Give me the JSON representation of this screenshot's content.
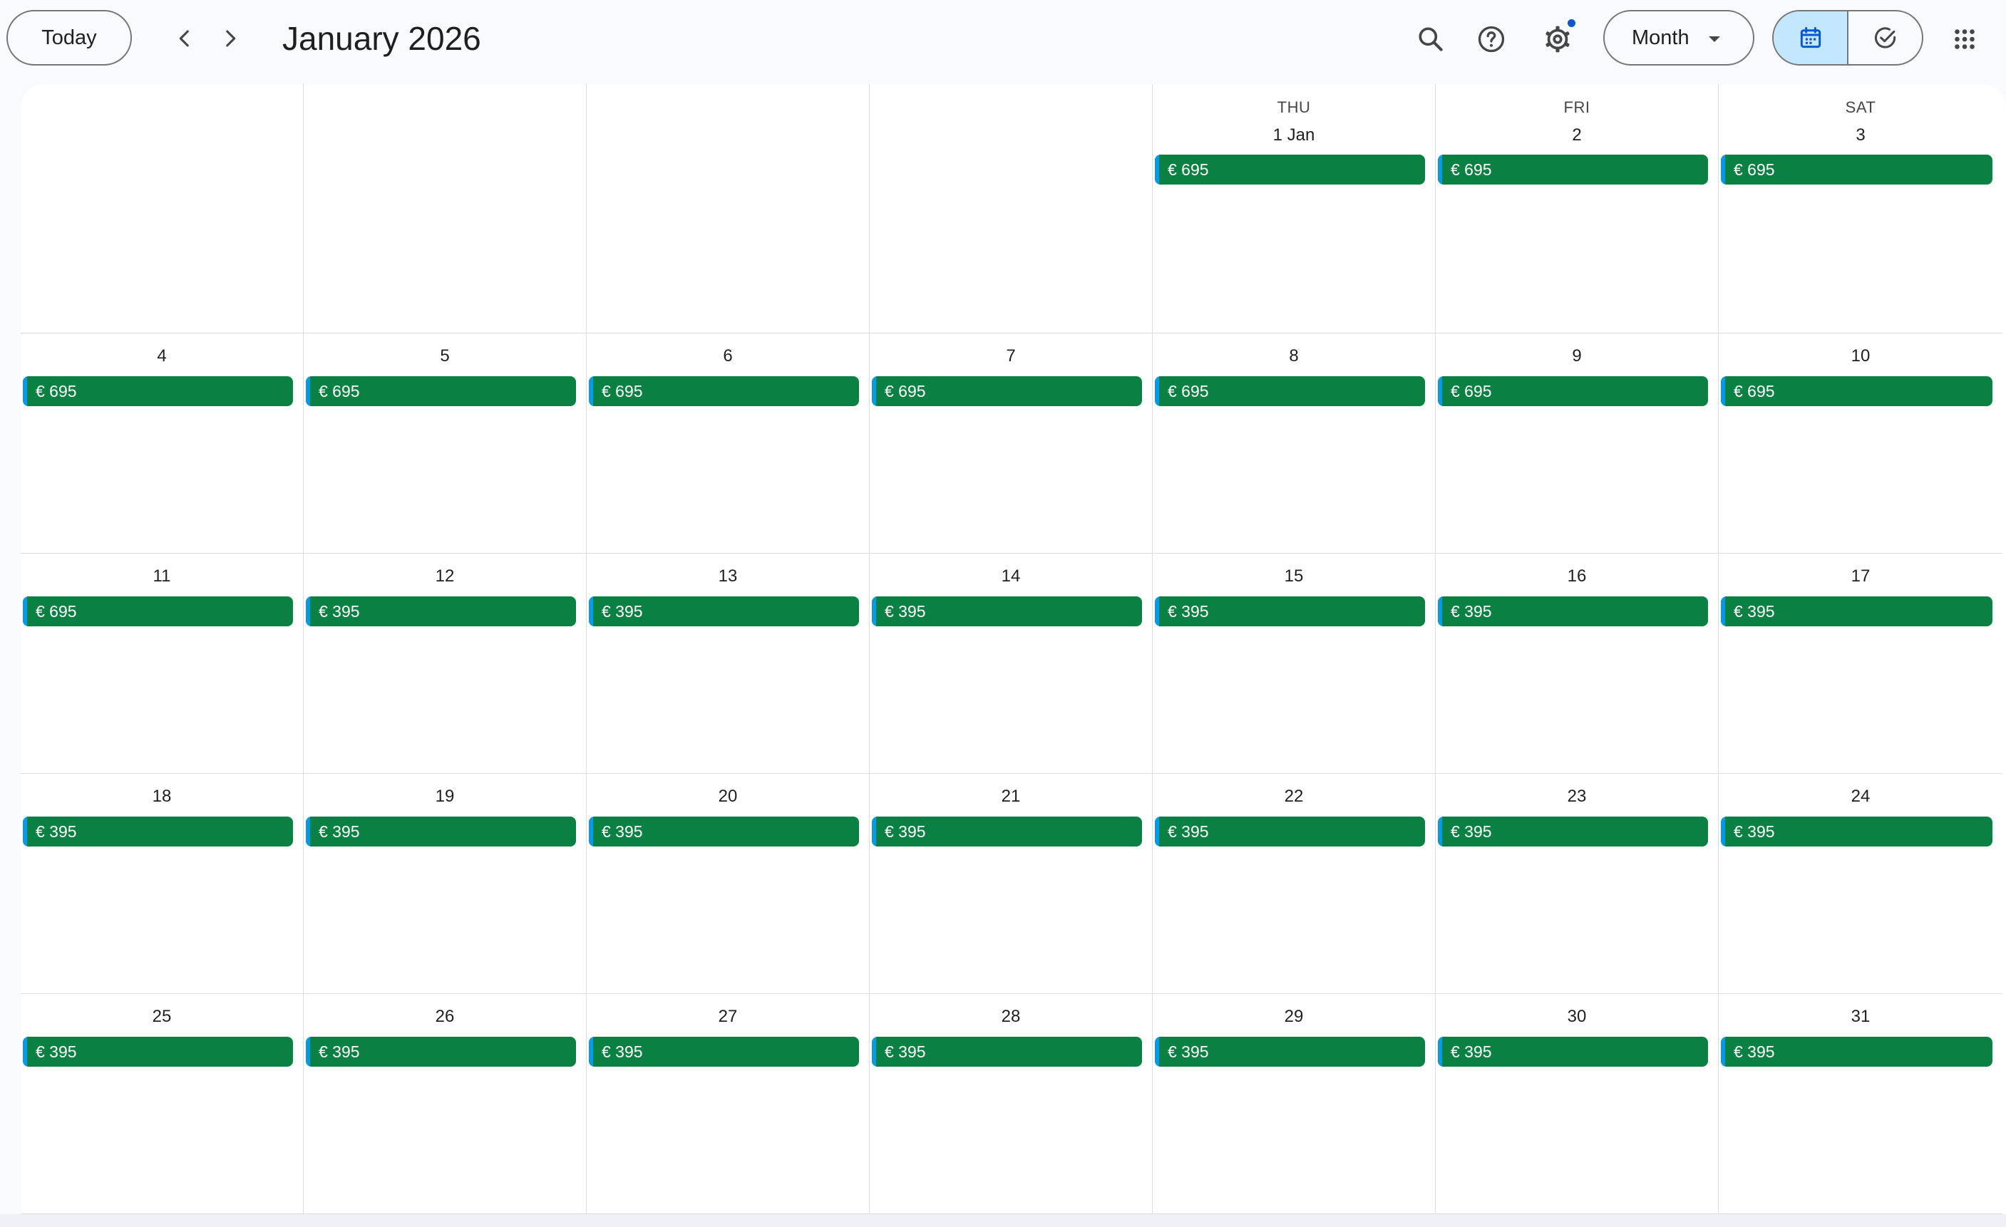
{
  "header": {
    "today_label": "Today",
    "month_title": "January 2026",
    "view_label": "Month",
    "icons": [
      "chevron-left-icon",
      "chevron-right-icon",
      "search-icon",
      "help-icon",
      "settings-icon",
      "calendar-icon",
      "task-check-icon",
      "apps-grid-icon"
    ]
  },
  "colors": {
    "event_bg": "#0b8043",
    "event_stripe": "#039be5",
    "active_toggle": "#c2e7ff",
    "notif_dot": "#0b57d0"
  },
  "weekday_headers": {
    "thu": "THU",
    "fri": "FRI",
    "sat": "SAT"
  },
  "weeks": [
    [
      {
        "day": "",
        "event": ""
      },
      {
        "day": "",
        "event": ""
      },
      {
        "day": "",
        "event": ""
      },
      {
        "day": "",
        "event": ""
      },
      {
        "day": "1 Jan",
        "dow": "THU",
        "event": "€ 695"
      },
      {
        "day": "2",
        "dow": "FRI",
        "event": "€ 695"
      },
      {
        "day": "3",
        "dow": "SAT",
        "event": "€ 695"
      }
    ],
    [
      {
        "day": "4",
        "event": "€ 695"
      },
      {
        "day": "5",
        "event": "€ 695"
      },
      {
        "day": "6",
        "event": "€ 695"
      },
      {
        "day": "7",
        "event": "€ 695"
      },
      {
        "day": "8",
        "event": "€ 695"
      },
      {
        "day": "9",
        "event": "€ 695"
      },
      {
        "day": "10",
        "event": "€ 695"
      }
    ],
    [
      {
        "day": "11",
        "event": "€ 695"
      },
      {
        "day": "12",
        "event": "€ 395"
      },
      {
        "day": "13",
        "event": "€ 395"
      },
      {
        "day": "14",
        "event": "€ 395"
      },
      {
        "day": "15",
        "event": "€ 395"
      },
      {
        "day": "16",
        "event": "€ 395"
      },
      {
        "day": "17",
        "event": "€ 395"
      }
    ],
    [
      {
        "day": "18",
        "event": "€ 395"
      },
      {
        "day": "19",
        "event": "€ 395"
      },
      {
        "day": "20",
        "event": "€ 395"
      },
      {
        "day": "21",
        "event": "€ 395"
      },
      {
        "day": "22",
        "event": "€ 395"
      },
      {
        "day": "23",
        "event": "€ 395"
      },
      {
        "day": "24",
        "event": "€ 395"
      }
    ],
    [
      {
        "day": "25",
        "event": "€ 395"
      },
      {
        "day": "26",
        "event": "€ 395"
      },
      {
        "day": "27",
        "event": "€ 395"
      },
      {
        "day": "28",
        "event": "€ 395"
      },
      {
        "day": "29",
        "event": "€ 395"
      },
      {
        "day": "30",
        "event": "€ 395"
      },
      {
        "day": "31",
        "event": "€ 395"
      }
    ]
  ]
}
